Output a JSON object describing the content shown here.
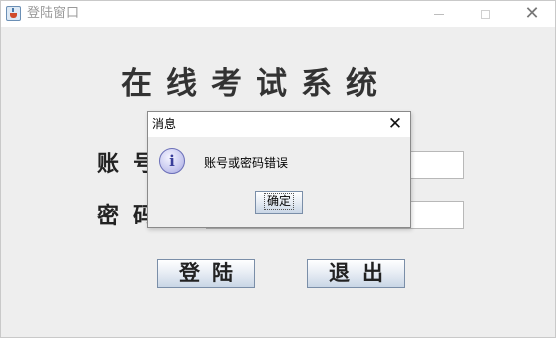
{
  "window": {
    "title": "登陆窗口",
    "min_icon": "minimize-icon",
    "max_icon": "maximize-icon",
    "close_icon": "close-icon",
    "close_glyph": "✕"
  },
  "main": {
    "system_title": "在线考试系统",
    "account_label": "账号",
    "password_label": "密码",
    "account_value": "",
    "password_value": "",
    "login_button": "登陆",
    "exit_button": "退出"
  },
  "dialog": {
    "title": "消息",
    "close_glyph": "✕",
    "icon": "information-icon",
    "icon_glyph": "i",
    "message": "账号或密码错误",
    "ok_button": "确定"
  },
  "colors": {
    "window_bg": "#eeeeee",
    "button_border": "#7a8ea8",
    "info_icon": "#6b6fb8"
  }
}
